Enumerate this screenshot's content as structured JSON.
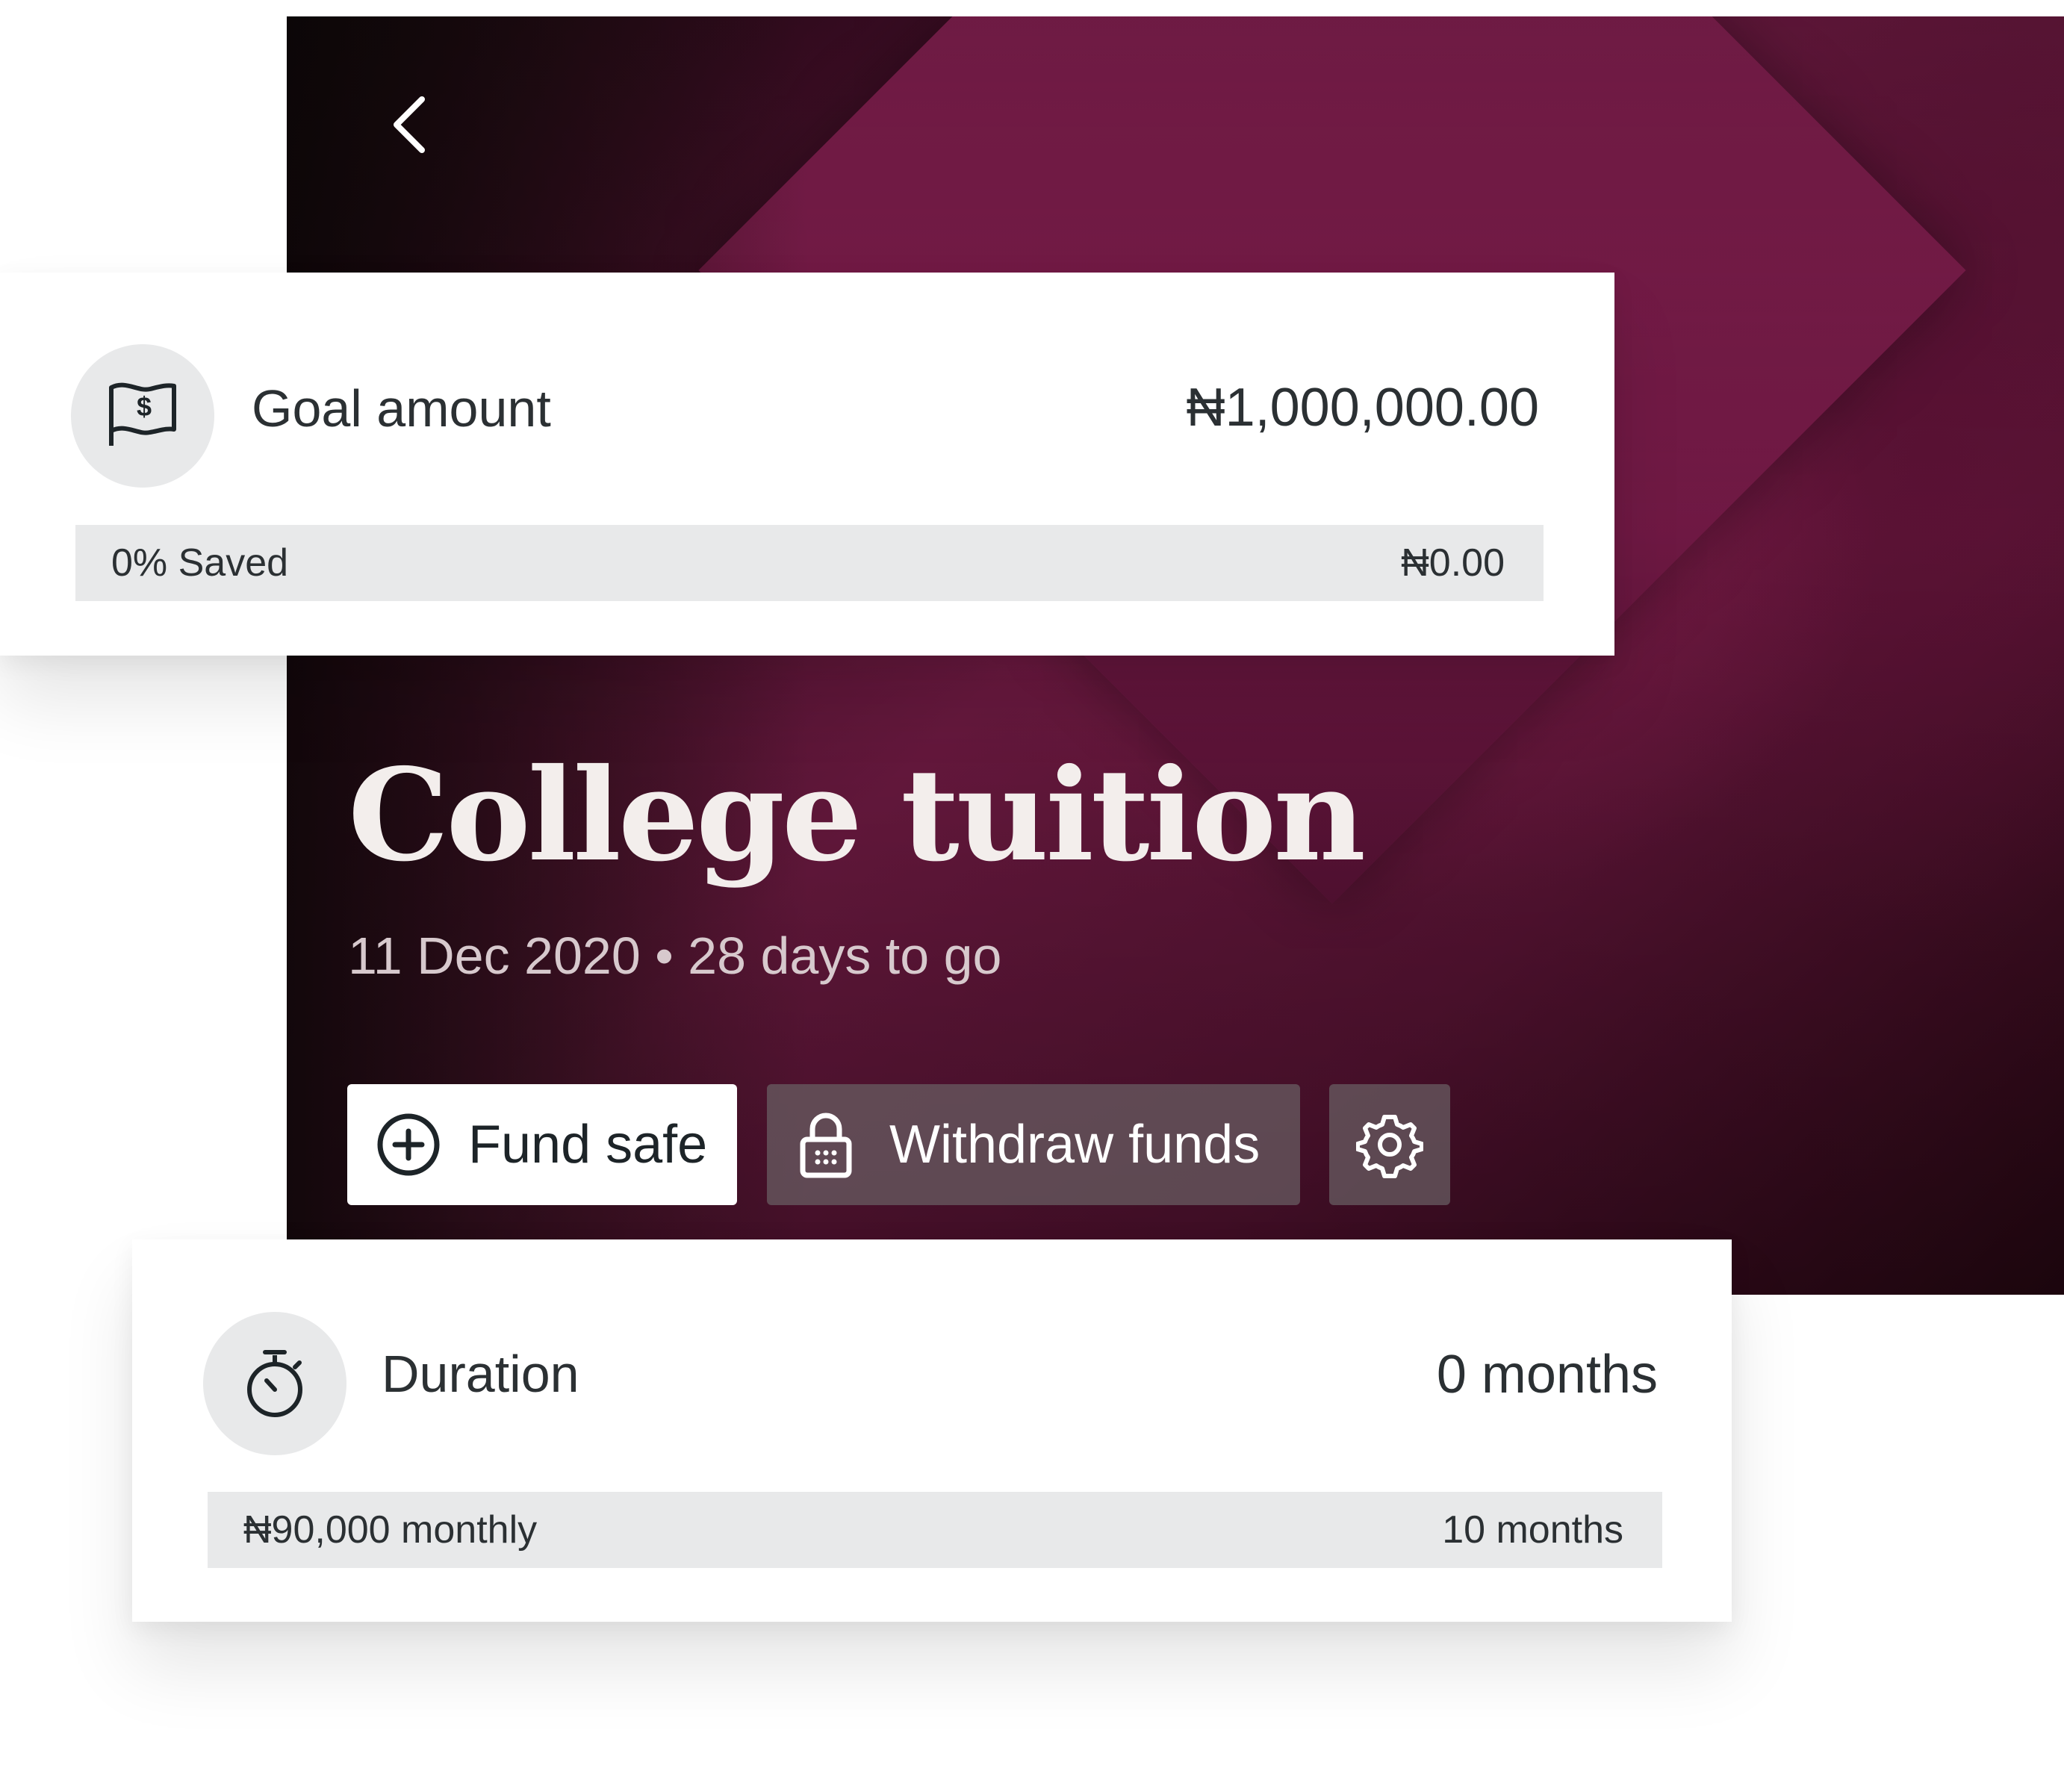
{
  "hero": {
    "title": "College tuition",
    "subtitle": "11 Dec 2020 • 28 days to go",
    "back_icon": "chevron-left-icon"
  },
  "actions": {
    "fund_label": "Fund safe",
    "fund_icon": "plus-circle-icon",
    "withdraw_label": "Withdraw funds",
    "withdraw_icon": "lock-icon",
    "settings_icon": "gear-icon"
  },
  "goal": {
    "icon": "money-flag-icon",
    "label": "Goal amount",
    "value": "₦1,000,000.00",
    "saved_label": "0% Saved",
    "saved_amount": "₦0.00"
  },
  "duration": {
    "icon": "stopwatch-icon",
    "label": "Duration",
    "value": "0 months",
    "monthly_label": "₦90,000 monthly",
    "total_months": "10 months"
  },
  "colors": {
    "hero_accent": "#7a1c4a",
    "card_bg": "#ffffff",
    "strip_bg": "#e8e9ea",
    "text_dark": "#2b3033"
  }
}
